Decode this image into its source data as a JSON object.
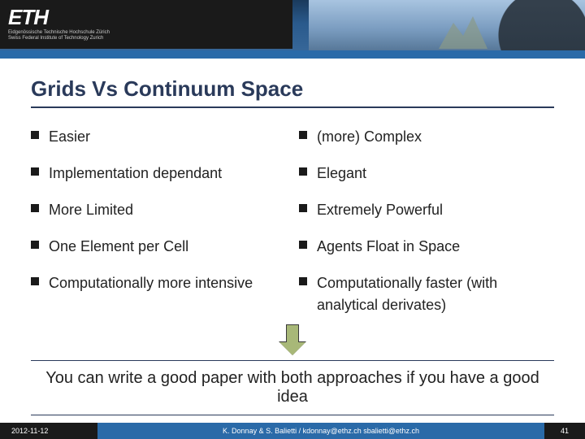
{
  "header": {
    "logo": "ETH",
    "logo_sub1": "Eidgenössische Technische Hochschule Zürich",
    "logo_sub2": "Swiss Federal Institute of Technology Zurich"
  },
  "title": "Grids Vs Continuum Space",
  "left_col": [
    "Easier",
    "Implementation dependant",
    "More Limited",
    "One Element per Cell",
    "Computationally more intensive"
  ],
  "right_col": [
    "(more) Complex",
    "Elegant",
    "Extremely Powerful",
    "Agents Float in Space",
    "Computationally faster (with analytical derivates)"
  ],
  "conclusion": "You can write a good paper with both approaches if you have a good idea",
  "footer": {
    "date": "2012-11-12",
    "mid": "K. Donnay & S. Balietti / kdonnay@ethz.ch  sbalietti@ethz.ch",
    "page": "41"
  }
}
